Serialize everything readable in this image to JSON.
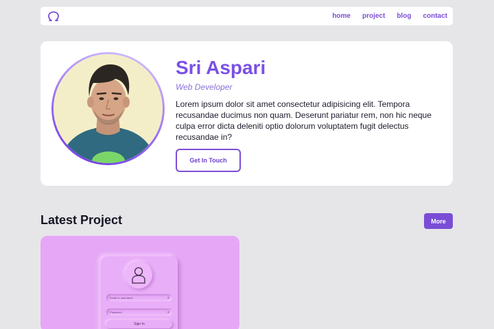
{
  "nav": {
    "logo_icon": "omega-logo-icon",
    "links": [
      {
        "label": "home"
      },
      {
        "label": "project"
      },
      {
        "label": "blog"
      },
      {
        "label": "contact"
      }
    ]
  },
  "hero": {
    "name": "Sri Aspari",
    "role": "Web Developer",
    "description": "Lorem ipsum dolor sit amet consectetur adipisicing elit. Tempora recusandae ducimus non quam. Deserunt pariatur rem, non hic neque culpa error dicta deleniti optio dolorum voluptatem fugit delectus recusandae in?",
    "cta_label": "Get In Touch"
  },
  "latest": {
    "title": "Latest Project",
    "more_label": "More",
    "project": {
      "email_placeholder": "Email or username",
      "password_placeholder": "Password",
      "signin_label": "Sign In"
    }
  },
  "colors": {
    "accent": "#7b4dd6",
    "background": "#e6e6e9",
    "card": "#ffffff",
    "project_bg": "#e6a8f6"
  }
}
